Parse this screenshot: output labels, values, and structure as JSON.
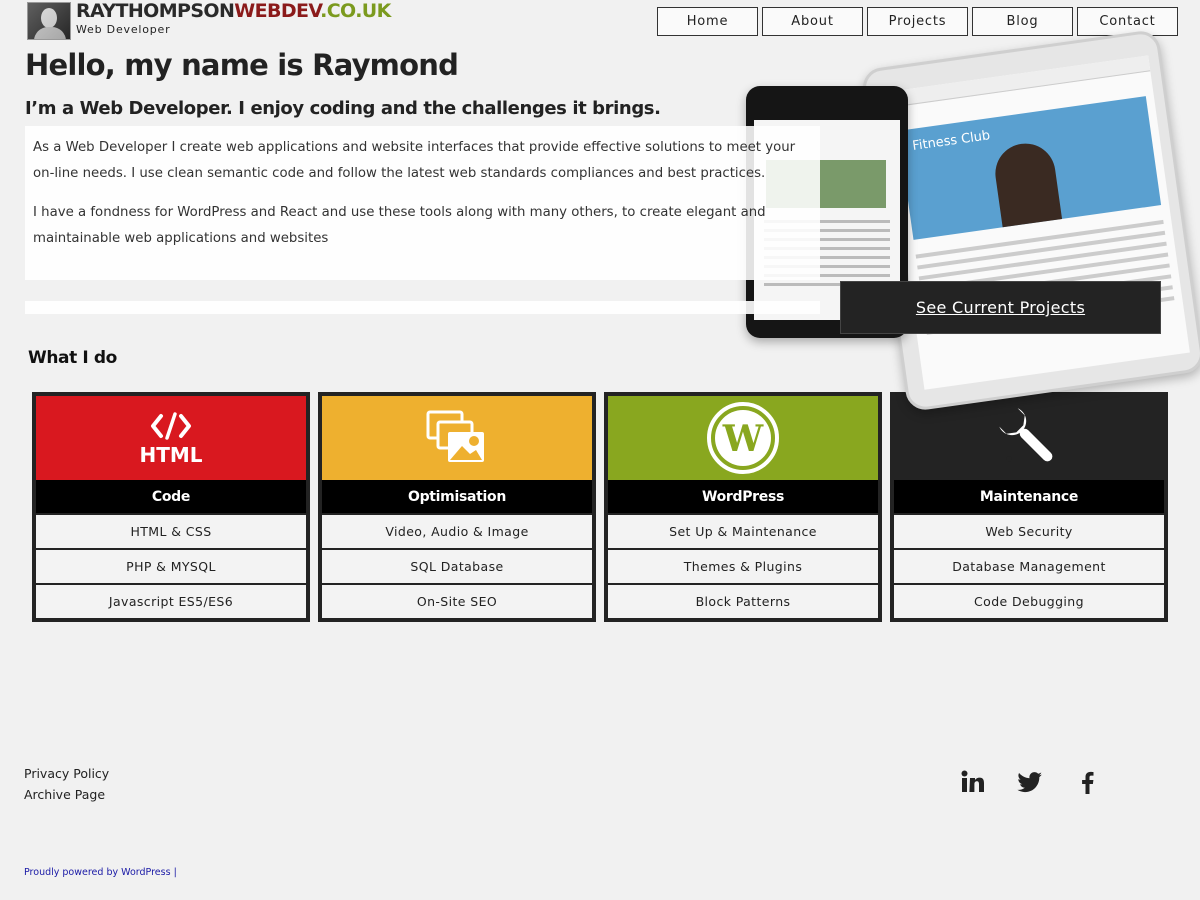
{
  "site": {
    "title_part1": "RAYTHOMPSON",
    "title_part2": "WEBDEV",
    "title_part3": ".CO.UK",
    "tagline": "Web Developer"
  },
  "nav": {
    "items": [
      {
        "label": "Home"
      },
      {
        "label": "About"
      },
      {
        "label": "Projects"
      },
      {
        "label": "Blog"
      },
      {
        "label": "Contact"
      }
    ]
  },
  "hero": {
    "title": "Hello, my name is Raymond",
    "subtitle": "I’m a Web Developer. I enjoy coding and the challenges it brings.",
    "paragraph1": "As a Web Developer I create web applications and website interfaces that provide effective solutions to meet your on-line needs. I use clean semantic code and follow the latest web standards compliances and best practices.",
    "paragraph2": "I have a fondness for WordPress and React and use these tools along with many others, to create elegant and maintainable web applications and websites",
    "cta_label": "See Current Projects",
    "tablet_heading": "Fitness Club"
  },
  "services": {
    "title": "What I do",
    "cards": [
      {
        "heading": "Code",
        "icon": "html-code-icon",
        "icon_text": "HTML",
        "color": "#d9181f",
        "items": [
          "HTML & CSS",
          "PHP & MYSQL",
          "Javascript ES5/ES6"
        ]
      },
      {
        "heading": "Optimisation",
        "icon": "images-icon",
        "color": "#eeb02f",
        "items": [
          "Video, Audio & Image",
          "SQL Database",
          "On-Site SEO"
        ]
      },
      {
        "heading": "WordPress",
        "icon": "wordpress-icon",
        "color": "#89a71f",
        "items": [
          "Set Up & Maintenance",
          "Themes & Plugins",
          "Block Patterns"
        ]
      },
      {
        "heading": "Maintenance",
        "icon": "wrench-icon",
        "color": "#232323",
        "items": [
          "Web Security",
          "Database Management",
          "Code Debugging"
        ]
      }
    ]
  },
  "footer": {
    "privacy": "Privacy Policy",
    "archive": "Archive Page",
    "powered": "Proudly powered by WordPress |",
    "social": [
      "linkedin-icon",
      "twitter-icon",
      "facebook-icon"
    ]
  }
}
